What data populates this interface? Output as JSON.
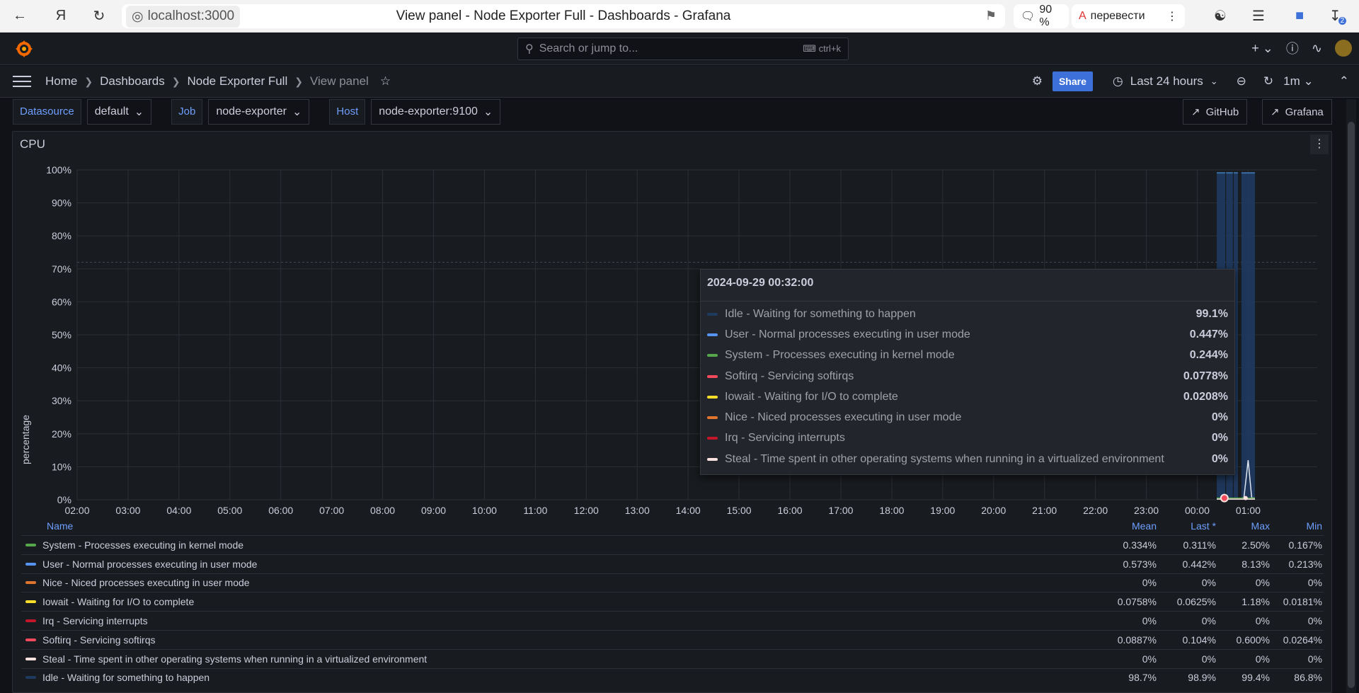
{
  "browser": {
    "url": "localhost:3000",
    "title": "View panel - Node Exporter Full - Dashboards - Grafana",
    "zoom": "90 %",
    "translate": "перевести",
    "download_badge": "2"
  },
  "topnav": {
    "search_placeholder": "Search or jump to...",
    "shortcut": "ctrl+k"
  },
  "breadcrumb": {
    "home": "Home",
    "dashboards": "Dashboards",
    "dashboard": "Node Exporter Full",
    "current": "View panel",
    "share": "Share",
    "time_range": "Last 24 hours",
    "refresh": "1m"
  },
  "variables": [
    {
      "label": "Datasource",
      "value": "default"
    },
    {
      "label": "Job",
      "value": "node-exporter"
    },
    {
      "label": "Host",
      "value": "node-exporter:9100"
    }
  ],
  "links": {
    "github": "GitHub",
    "grafana": "Grafana"
  },
  "panel": {
    "title": "CPU",
    "ylabel": "percentage"
  },
  "colors": {
    "System": "#56a64b",
    "User": "#5794f2",
    "Nice": "#e0752d",
    "Iowait": "#fade2a",
    "Irq": "#c4162a",
    "Softirq": "#f2495c",
    "Steal": "#fce2de",
    "Idle": "#1f3a5f"
  },
  "chart_data": {
    "type": "area",
    "x_ticks": [
      "02:00",
      "03:00",
      "04:00",
      "05:00",
      "06:00",
      "07:00",
      "08:00",
      "09:00",
      "10:00",
      "11:00",
      "12:00",
      "13:00",
      "14:00",
      "15:00",
      "16:00",
      "17:00",
      "18:00",
      "19:00",
      "20:00",
      "21:00",
      "22:00",
      "23:00",
      "00:00",
      "01:00"
    ],
    "y_ticks": [
      "0%",
      "10%",
      "20%",
      "30%",
      "40%",
      "50%",
      "60%",
      "70%",
      "80%",
      "90%",
      "100%"
    ],
    "ylim": [
      0,
      100
    ],
    "ylabel": "percentage",
    "series": [
      {
        "name": "Idle - Waiting for something to happen",
        "key": "Idle",
        "points": [
          [
            "00:23",
            99.1
          ],
          [
            "00:32",
            99.1
          ],
          [
            "00:42",
            98.9
          ],
          [
            "00:55",
            98.9
          ],
          [
            "01:05",
            98.9
          ]
        ]
      },
      {
        "name": "User - Normal processes executing in user mode",
        "key": "User",
        "points": [
          [
            "00:32",
            0.447
          ],
          [
            "01:00",
            8.13
          ],
          [
            "01:05",
            0.442
          ]
        ]
      },
      {
        "name": "System - Processes executing in kernel mode",
        "key": "System",
        "points": [
          [
            "00:32",
            0.244
          ],
          [
            "01:05",
            0.311
          ]
        ]
      }
    ],
    "threshold": 72
  },
  "tooltip": {
    "time": "2024-09-29 00:32:00",
    "rows": [
      {
        "key": "Idle",
        "name": "Idle - Waiting for something to happen",
        "value": "99.1%"
      },
      {
        "key": "User",
        "name": "User - Normal processes executing in user mode",
        "value": "0.447%"
      },
      {
        "key": "System",
        "name": "System - Processes executing in kernel mode",
        "value": "0.244%"
      },
      {
        "key": "Softirq",
        "name": "Softirq - Servicing softirqs",
        "value": "0.0778%"
      },
      {
        "key": "Iowait",
        "name": "Iowait - Waiting for I/O to complete",
        "value": "0.0208%"
      },
      {
        "key": "Nice",
        "name": "Nice - Niced processes executing in user mode",
        "value": "0%"
      },
      {
        "key": "Irq",
        "name": "Irq - Servicing interrupts",
        "value": "0%"
      },
      {
        "key": "Steal",
        "name": "Steal - Time spent in other operating systems when running in a virtualized environment",
        "value": "0%"
      }
    ]
  },
  "legend": {
    "headers": {
      "name": "Name",
      "mean": "Mean",
      "last": "Last *",
      "max": "Max",
      "min": "Min"
    },
    "rows": [
      {
        "key": "System",
        "name": "System - Processes executing in kernel mode",
        "mean": "0.334%",
        "last": "0.311%",
        "max": "2.50%",
        "min": "0.167%"
      },
      {
        "key": "User",
        "name": "User - Normal processes executing in user mode",
        "mean": "0.573%",
        "last": "0.442%",
        "max": "8.13%",
        "min": "0.213%"
      },
      {
        "key": "Nice",
        "name": "Nice - Niced processes executing in user mode",
        "mean": "0%",
        "last": "0%",
        "max": "0%",
        "min": "0%"
      },
      {
        "key": "Iowait",
        "name": "Iowait - Waiting for I/O to complete",
        "mean": "0.0758%",
        "last": "0.0625%",
        "max": "1.18%",
        "min": "0.0181%"
      },
      {
        "key": "Irq",
        "name": "Irq - Servicing interrupts",
        "mean": "0%",
        "last": "0%",
        "max": "0%",
        "min": "0%"
      },
      {
        "key": "Softirq",
        "name": "Softirq - Servicing softirqs",
        "mean": "0.0887%",
        "last": "0.104%",
        "max": "0.600%",
        "min": "0.0264%"
      },
      {
        "key": "Steal",
        "name": "Steal - Time spent in other operating systems when running in a virtualized environment",
        "mean": "0%",
        "last": "0%",
        "max": "0%",
        "min": "0%"
      },
      {
        "key": "Idle",
        "name": "Idle - Waiting for something to happen",
        "mean": "98.7%",
        "last": "98.9%",
        "max": "99.4%",
        "min": "86.8%"
      }
    ]
  }
}
